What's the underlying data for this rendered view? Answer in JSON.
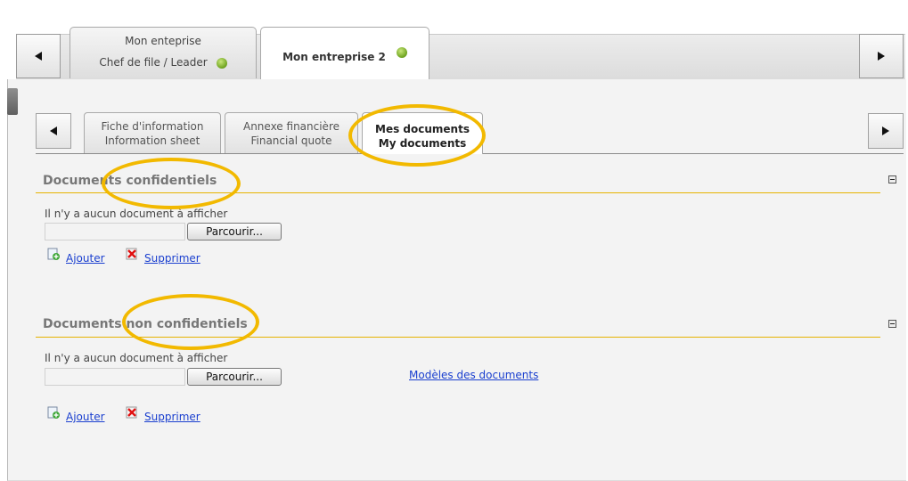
{
  "top_tabs": [
    {
      "line1": "Mon enteprise",
      "line2": "Chef de file / Leader"
    },
    {
      "label": "Mon entreprise 2"
    }
  ],
  "inner_tabs": [
    {
      "line1": "Fiche d'information",
      "line2": "Information sheet"
    },
    {
      "line1": "Annexe financière",
      "line2": "Financial quote"
    },
    {
      "line1": "Mes documents",
      "line2": "My documents"
    }
  ],
  "sections": {
    "confidential": {
      "title": "Documents confidentiels",
      "empty_message": "Il n'y a aucun document à afficher",
      "browse_label": "Parcourir...",
      "add_label": "Ajouter",
      "delete_label": "Supprimer"
    },
    "non_confidential": {
      "title": "Documents non confidentiels",
      "empty_message": "Il n'y a aucun document à afficher",
      "browse_label": "Parcourir...",
      "add_label": "Ajouter",
      "delete_label": "Supprimer",
      "models_link": "Modèles des documents"
    }
  },
  "colors": {
    "highlight": "#f2b900",
    "link": "#1a3fcf",
    "status": "#6da21e"
  }
}
